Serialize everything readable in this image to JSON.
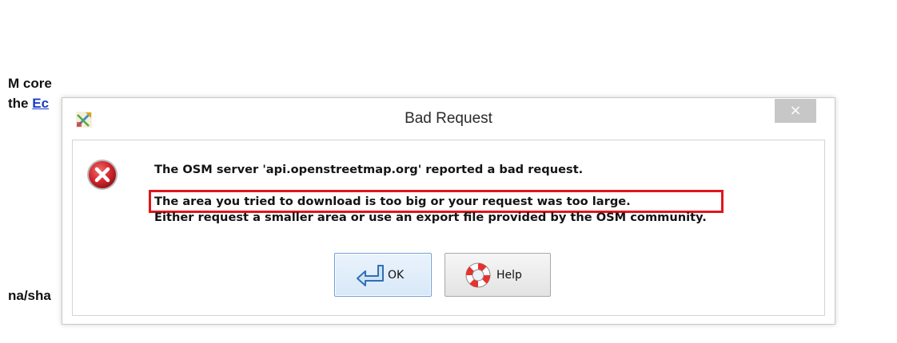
{
  "background": {
    "line1": "M core",
    "line2_prefix": "the ",
    "line2_link": "Ec",
    "line3": "na/sha"
  },
  "dialog": {
    "title": "Bad Request",
    "close_label": "×",
    "message": {
      "line1": "The OSM server 'api.openstreetmap.org' reported a bad request.",
      "line2": "The area you tried to download is too big or your request was too large.",
      "line3": "Either request a smaller area or use an export file provided by the OSM community."
    },
    "buttons": {
      "ok_label": "OK",
      "help_label": "Help"
    }
  },
  "icons": {
    "app": "josm-app-icon",
    "error": "error-icon",
    "ok": "ok-arrow-icon",
    "help": "lifebuoy-help-icon",
    "close": "close-icon"
  },
  "colors": {
    "highlight_border": "#e0161d",
    "error_red": "#c9232a",
    "link": "#1a3cc8",
    "close_button_bg": "#c7c7c7"
  }
}
